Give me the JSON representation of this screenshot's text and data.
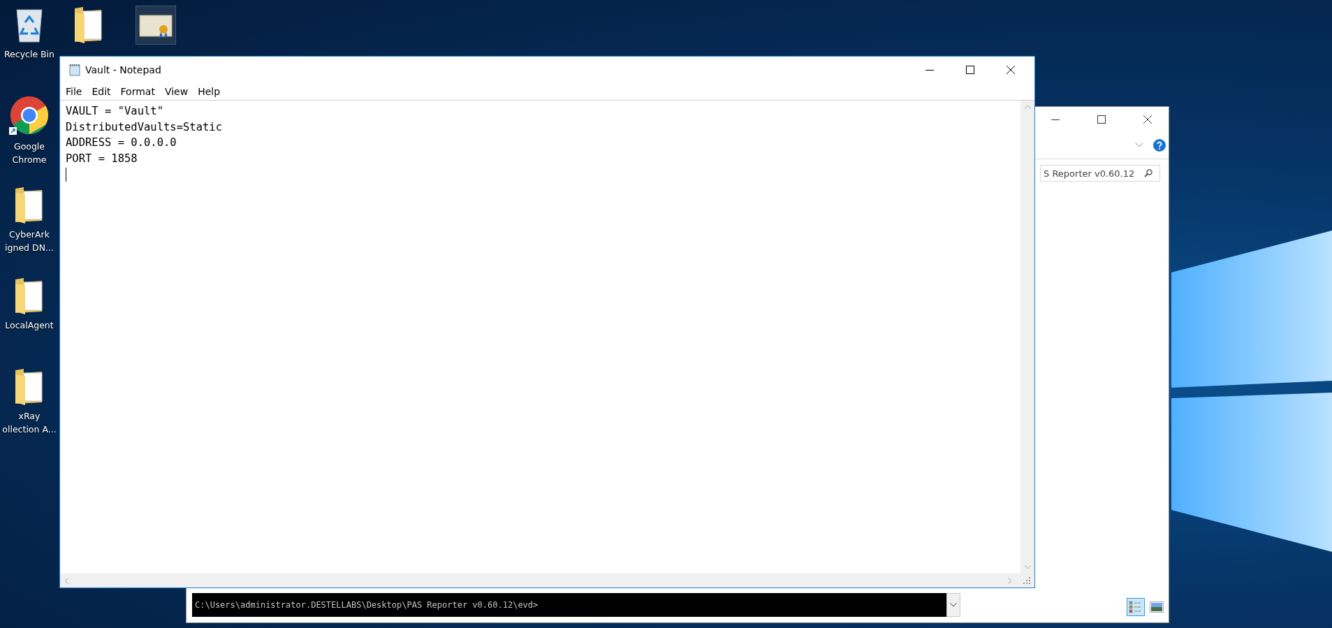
{
  "desktop_icons": [
    {
      "kind": "recycle",
      "label": [
        "Recycle Bin"
      ]
    },
    {
      "kind": "chrome",
      "label": [
        "Google",
        "Chrome"
      ]
    },
    {
      "kind": "folder",
      "label": [
        "CyberArk",
        "igned DN..."
      ]
    },
    {
      "kind": "folder",
      "label": [
        "LocalAgent"
      ]
    },
    {
      "kind": "folder",
      "label": [
        "xRay",
        "ollection A..."
      ]
    }
  ],
  "top_icons": [
    {
      "kind": "folder"
    },
    {
      "kind": "certificate"
    }
  ],
  "explorer": {
    "search": {
      "value": "S Reporter v0.60.12"
    },
    "console": {
      "text": "C:\\Users\\administrator.DESTELLABS\\Desktop\\PAS Reporter v0.60.12\\evd>"
    },
    "views": [
      {
        "kind": "details",
        "selected": true
      },
      {
        "kind": "preview",
        "selected": false
      }
    ]
  },
  "notepad": {
    "title": "Vault - Notepad",
    "menu": [
      "File",
      "Edit",
      "Format",
      "View",
      "Help"
    ],
    "lines": [
      "VAULT = \"Vault\"",
      "DistributedVaults=Static",
      "ADDRESS = 0.0.0.0",
      "PORT = 1858"
    ]
  }
}
